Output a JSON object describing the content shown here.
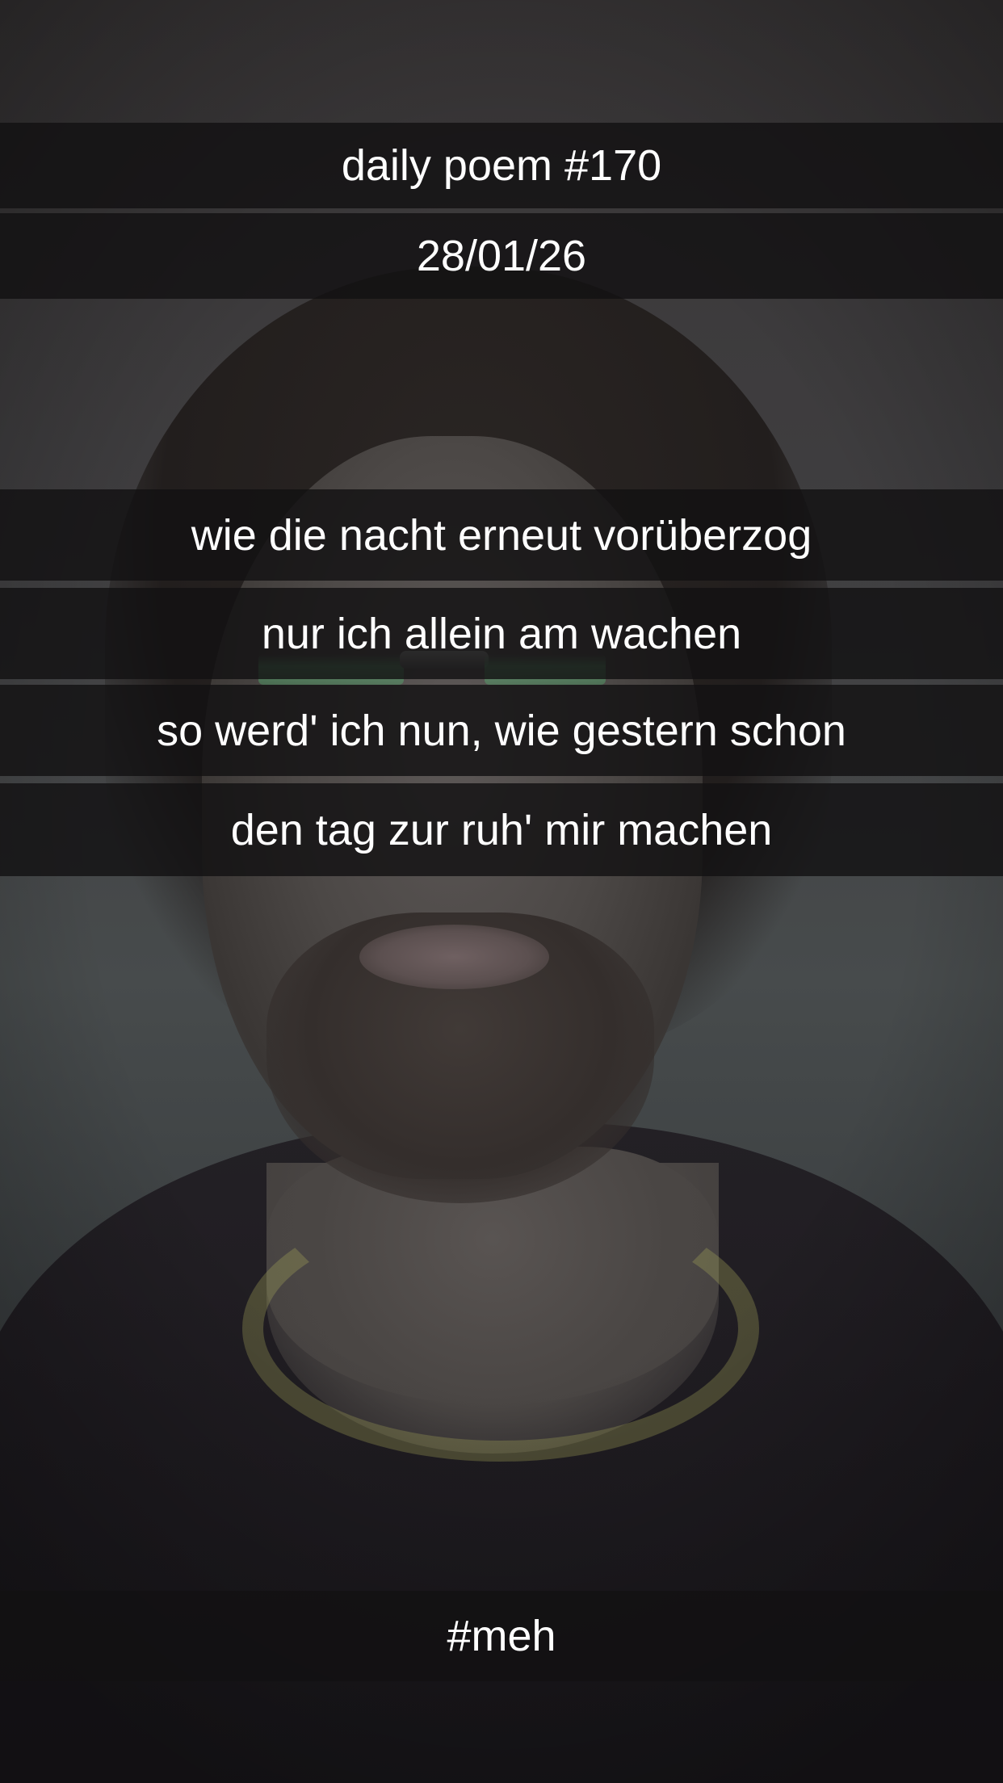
{
  "header": {
    "title": "daily poem #170",
    "date": "28/01/26"
  },
  "poem": {
    "lines": [
      "wie die nacht erneut vorüberzog",
      "nur ich allein am wachen",
      "so werd' ich nun, wie gestern schon",
      "den tag zur ruh' mir machen"
    ]
  },
  "footer": {
    "hashtag": "#meh"
  }
}
